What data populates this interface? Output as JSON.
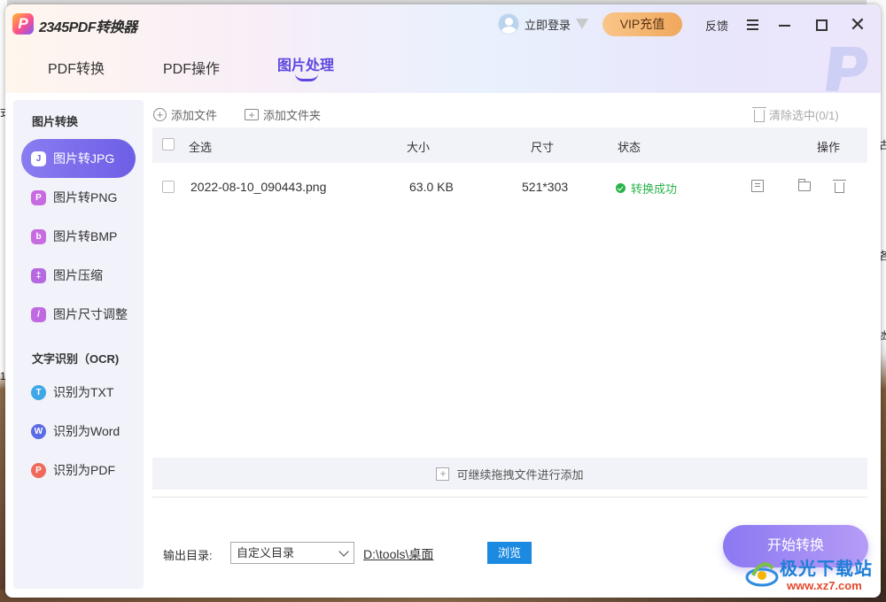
{
  "background": {
    "left_chars": [
      "式",
      "1"
    ],
    "right_chars": [
      "古",
      "各",
      "凼"
    ]
  },
  "app": {
    "logo_glyph": "P",
    "title": "2345PDF转换器"
  },
  "header": {
    "login_label": "立即登录",
    "vip_label": "VIP充值",
    "feedback_label": "反馈"
  },
  "tabs": [
    {
      "label": "PDF转换",
      "active": false
    },
    {
      "label": "PDF操作",
      "active": false
    },
    {
      "label": "图片处理",
      "active": true
    }
  ],
  "sidebar": {
    "section1": "图片转换",
    "section2": "文字识别（OCR)",
    "items": [
      {
        "label": "图片转JPG",
        "icon": "image-jpg-icon",
        "glyph": "J",
        "color": "#ffffff",
        "active": true
      },
      {
        "label": "图片转PNG",
        "icon": "image-png-icon",
        "glyph": "P",
        "color": "#c76ce0",
        "active": false
      },
      {
        "label": "图片转BMP",
        "icon": "image-bmp-icon",
        "glyph": "b",
        "color": "#c76ce0",
        "active": false
      },
      {
        "label": "图片压缩",
        "icon": "image-compress-icon",
        "glyph": "‡",
        "color": "#b568e0",
        "active": false
      },
      {
        "label": "图片尺寸调整",
        "icon": "image-resize-icon",
        "glyph": "/",
        "color": "#c06ae2",
        "active": false
      },
      {
        "label": "识别为TXT",
        "icon": "ocr-txt-icon",
        "glyph": "T",
        "color": "#3fa7e8",
        "active": false
      },
      {
        "label": "识别为Word",
        "icon": "ocr-word-icon",
        "glyph": "W",
        "color": "#5b6ce6",
        "active": false
      },
      {
        "label": "识别为PDF",
        "icon": "ocr-pdf-icon",
        "glyph": "P",
        "color": "#f06a5c",
        "active": false
      }
    ]
  },
  "toolbar": {
    "add_file": "添加文件",
    "add_folder": "添加文件夹",
    "clear_selected": "清除选中(0/1)"
  },
  "table": {
    "headers": {
      "select_all": "全选",
      "size": "大小",
      "dimensions": "尺寸",
      "status": "状态",
      "actions": "操作"
    },
    "rows": [
      {
        "name": "2022-08-10_090443.png",
        "size": "63.0 KB",
        "dimensions": "521*303",
        "status": "转换成功"
      }
    ]
  },
  "dropzone_text": "可继续拖拽文件进行添加",
  "output": {
    "label": "输出目录:",
    "selected": "自定义目录",
    "path": "D:\\tools\\桌面",
    "browse": "浏览"
  },
  "start_label": "开始转换",
  "colors": {
    "accent": "#5d47e0",
    "success": "#28b34a",
    "browse": "#1d8ae2"
  },
  "site_watermark": {
    "name": "极光下载站",
    "url": "www.xz7.com"
  }
}
